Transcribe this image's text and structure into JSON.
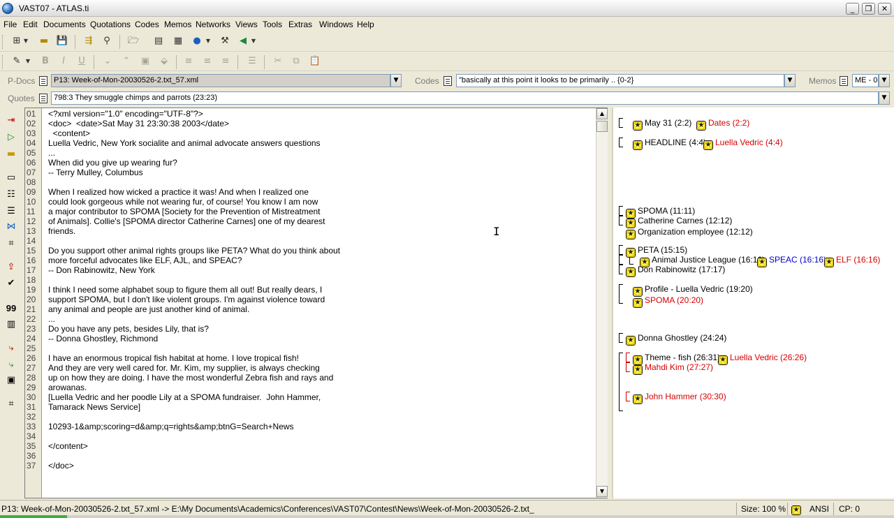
{
  "window": {
    "title": "VAST07 - ATLAS.ti"
  },
  "menu": [
    "File",
    "Edit",
    "Documents",
    "Quotations",
    "Codes",
    "Memos",
    "Networks",
    "Views",
    "Tools",
    "Extras",
    "Windows",
    "Help"
  ],
  "pdocs": {
    "label": "P-Docs",
    "value": "P13: Week-of-Mon-20030526-2.txt_57.xml"
  },
  "codes": {
    "label": "Codes",
    "value": "\"basically at this point it looks to be primarily .. {0-2}"
  },
  "memos": {
    "label": "Memos",
    "value": "ME - 0"
  },
  "quotes": {
    "label": "Quotes",
    "value": "798:3 They smuggle chimps and parrots (23:23)"
  },
  "editor": {
    "lines": [
      {
        "n": "01",
        "t": "<?xml version=\"1.0\" encoding=\"UTF-8\"?>"
      },
      {
        "n": "02",
        "t": "<doc>  <date>Sat May 31 23:30:38 2003</date>"
      },
      {
        "n": "03",
        "t": "  <content>"
      },
      {
        "n": "04",
        "t": "Luella Vedric, New York socialite and animal advocate answers questions"
      },
      {
        "n": "05",
        "t": "..."
      },
      {
        "n": "06",
        "t": "When did you give up wearing fur?"
      },
      {
        "n": "07",
        "t": "-- Terry Mulley, Columbus"
      },
      {
        "n": "08",
        "t": ""
      },
      {
        "n": "09",
        "t": "When I realized how wicked a practice it was! And when I realized one"
      },
      {
        "n": "10",
        "t": "could look gorgeous while not wearing fur, of course! You know I am now"
      },
      {
        "n": "11",
        "t": "a major contributor to SPOMA [Society for the Prevention of Mistreatment"
      },
      {
        "n": "12",
        "t": "of Animals]. Collie's [SPOMA director Catherine Carnes] one of my dearest"
      },
      {
        "n": "13",
        "t": "friends."
      },
      {
        "n": "14",
        "t": ""
      },
      {
        "n": "15",
        "t": "Do you support other animal rights groups like PETA? What do you think about"
      },
      {
        "n": "16",
        "t": "more forceful advocates like ELF, AJL, and SPEAC?"
      },
      {
        "n": "17",
        "t": "-- Don Rabinowitz, New York"
      },
      {
        "n": "18",
        "t": ""
      },
      {
        "n": "19",
        "t": "I think I need some alphabet soup to figure them all out! But really dears, I"
      },
      {
        "n": "20",
        "t": "support SPOMA, but I don't like violent groups. I'm against violence toward"
      },
      {
        "n": "21",
        "t": "any animal and people are just another kind of animal."
      },
      {
        "n": "22",
        "t": "..."
      },
      {
        "n": "23",
        "t": "Do you have any pets, besides Lily, that is?"
      },
      {
        "n": "24",
        "t": "-- Donna Ghostley, Richmond"
      },
      {
        "n": "25",
        "t": ""
      },
      {
        "n": "26",
        "t": "I have an enormous tropical fish habitat at home. I love tropical fish!"
      },
      {
        "n": "27",
        "t": "And they are very well cared for. Mr. Kim, my supplier, is always checking"
      },
      {
        "n": "28",
        "t": "up on how they are doing. I have the most wonderful Zebra fish and rays and"
      },
      {
        "n": "29",
        "t": "arowanas."
      },
      {
        "n": "30",
        "t": "[Luella Vedric and her poodle Lily at a SPOMA fundraiser.  John Hammer,"
      },
      {
        "n": "31",
        "t": "Tamarack News Service]"
      },
      {
        "n": "32",
        "t": ""
      },
      {
        "n": "33",
        "t": "10293-1&amp;scoring=d&amp;q=rights&amp;btnG=Search+News"
      },
      {
        "n": "34",
        "t": ""
      },
      {
        "n": "35",
        "t": "</content>"
      },
      {
        "n": "36",
        "t": ""
      },
      {
        "n": "37",
        "t": "</doc>"
      }
    ]
  },
  "margin": {
    "codes": [
      {
        "label": "May 31  (2:2)",
        "color": "black"
      },
      {
        "label": "Dates  (2:2)",
        "color": "red"
      },
      {
        "label": "HEADLINE  (4:4)",
        "color": "black"
      },
      {
        "label": "Luella Vedric  (4:4)",
        "color": "red"
      },
      {
        "label": "SPOMA  (11:11)",
        "color": "black"
      },
      {
        "label": "Catherine Carnes  (12:12)",
        "color": "black"
      },
      {
        "label": "Organization employee  (12:12)",
        "color": "black"
      },
      {
        "label": "PETA  (15:15)",
        "color": "black"
      },
      {
        "label": "Animal Justice League  (16:16)",
        "color": "black"
      },
      {
        "label": "SPEAC  (16:16)",
        "color": "blue"
      },
      {
        "label": "ELF  (16:16)",
        "color": "red"
      },
      {
        "label": "Don Rabinowitz  (17:17)",
        "color": "black"
      },
      {
        "label": "Profile - Luella Vedric  (19:20)",
        "color": "black"
      },
      {
        "label": "SPOMA  (20:20)",
        "color": "red"
      },
      {
        "label": "Donna Ghostley  (24:24)",
        "color": "black"
      },
      {
        "label": "Theme - fish  (26:31)",
        "color": "black"
      },
      {
        "label": "Luella Vedric  (26:26)",
        "color": "red"
      },
      {
        "label": "Mahdi Kim  (27:27)",
        "color": "red"
      },
      {
        "label": "John Hammer  (30:30)",
        "color": "red"
      }
    ]
  },
  "status": {
    "path": "P13: Week-of-Mon-20030526-2.txt_57.xml -> E:\\My Documents\\Academics\\Conferences\\VAST07\\Contest\\News\\Week-of-Mon-20030526-2.txt_",
    "size": "Size: 100 %",
    "encoding": "ANSI",
    "cp": "CP: 0"
  },
  "colors": {
    "code_red": "#d60000",
    "code_blue": "#0000d0",
    "chrome": "#ece9d8"
  }
}
